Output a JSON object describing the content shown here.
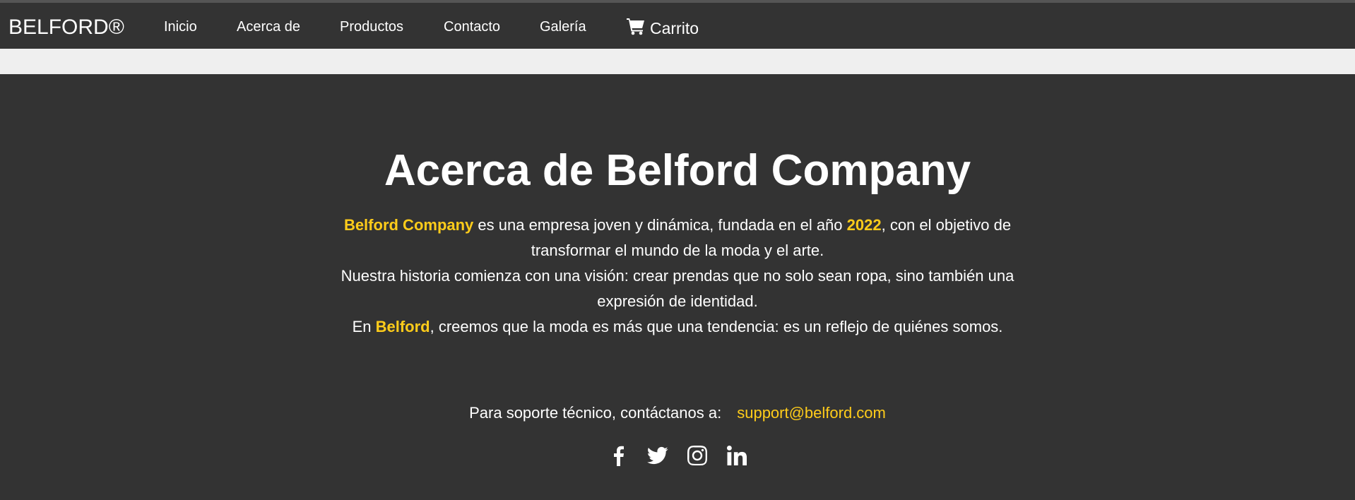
{
  "nav": {
    "brand": "BELFORD®",
    "links": [
      "Inicio",
      "Acerca de",
      "Productos",
      "Contacto",
      "Galería"
    ],
    "cart_label": "Carrito"
  },
  "about": {
    "title": "Acerca de Belford Company",
    "p1_highlight_company": "Belford Company",
    "p1_text_a": " es una empresa joven y dinámica, fundada en el año ",
    "p1_year": "2022",
    "p1_text_b": ", con el objetivo de transformar el mundo de la moda y el arte.",
    "p2": "Nuestra historia comienza con una visión: crear prendas que no solo sean ropa, sino también una expresión de identidad.",
    "p3_text_a": "En ",
    "p3_highlight": "Belford",
    "p3_text_b": ", creemos que la moda es más que una tendencia: es un reflejo de quiénes somos."
  },
  "support": {
    "label": "Para soporte técnico, contáctanos a:",
    "email": "support@belford.com"
  },
  "socials": [
    "facebook-icon",
    "twitter-icon",
    "instagram-icon",
    "linkedin-icon"
  ],
  "colors": {
    "background": "#333333",
    "accent": "#ffcc1a",
    "strip": "#efefef"
  }
}
